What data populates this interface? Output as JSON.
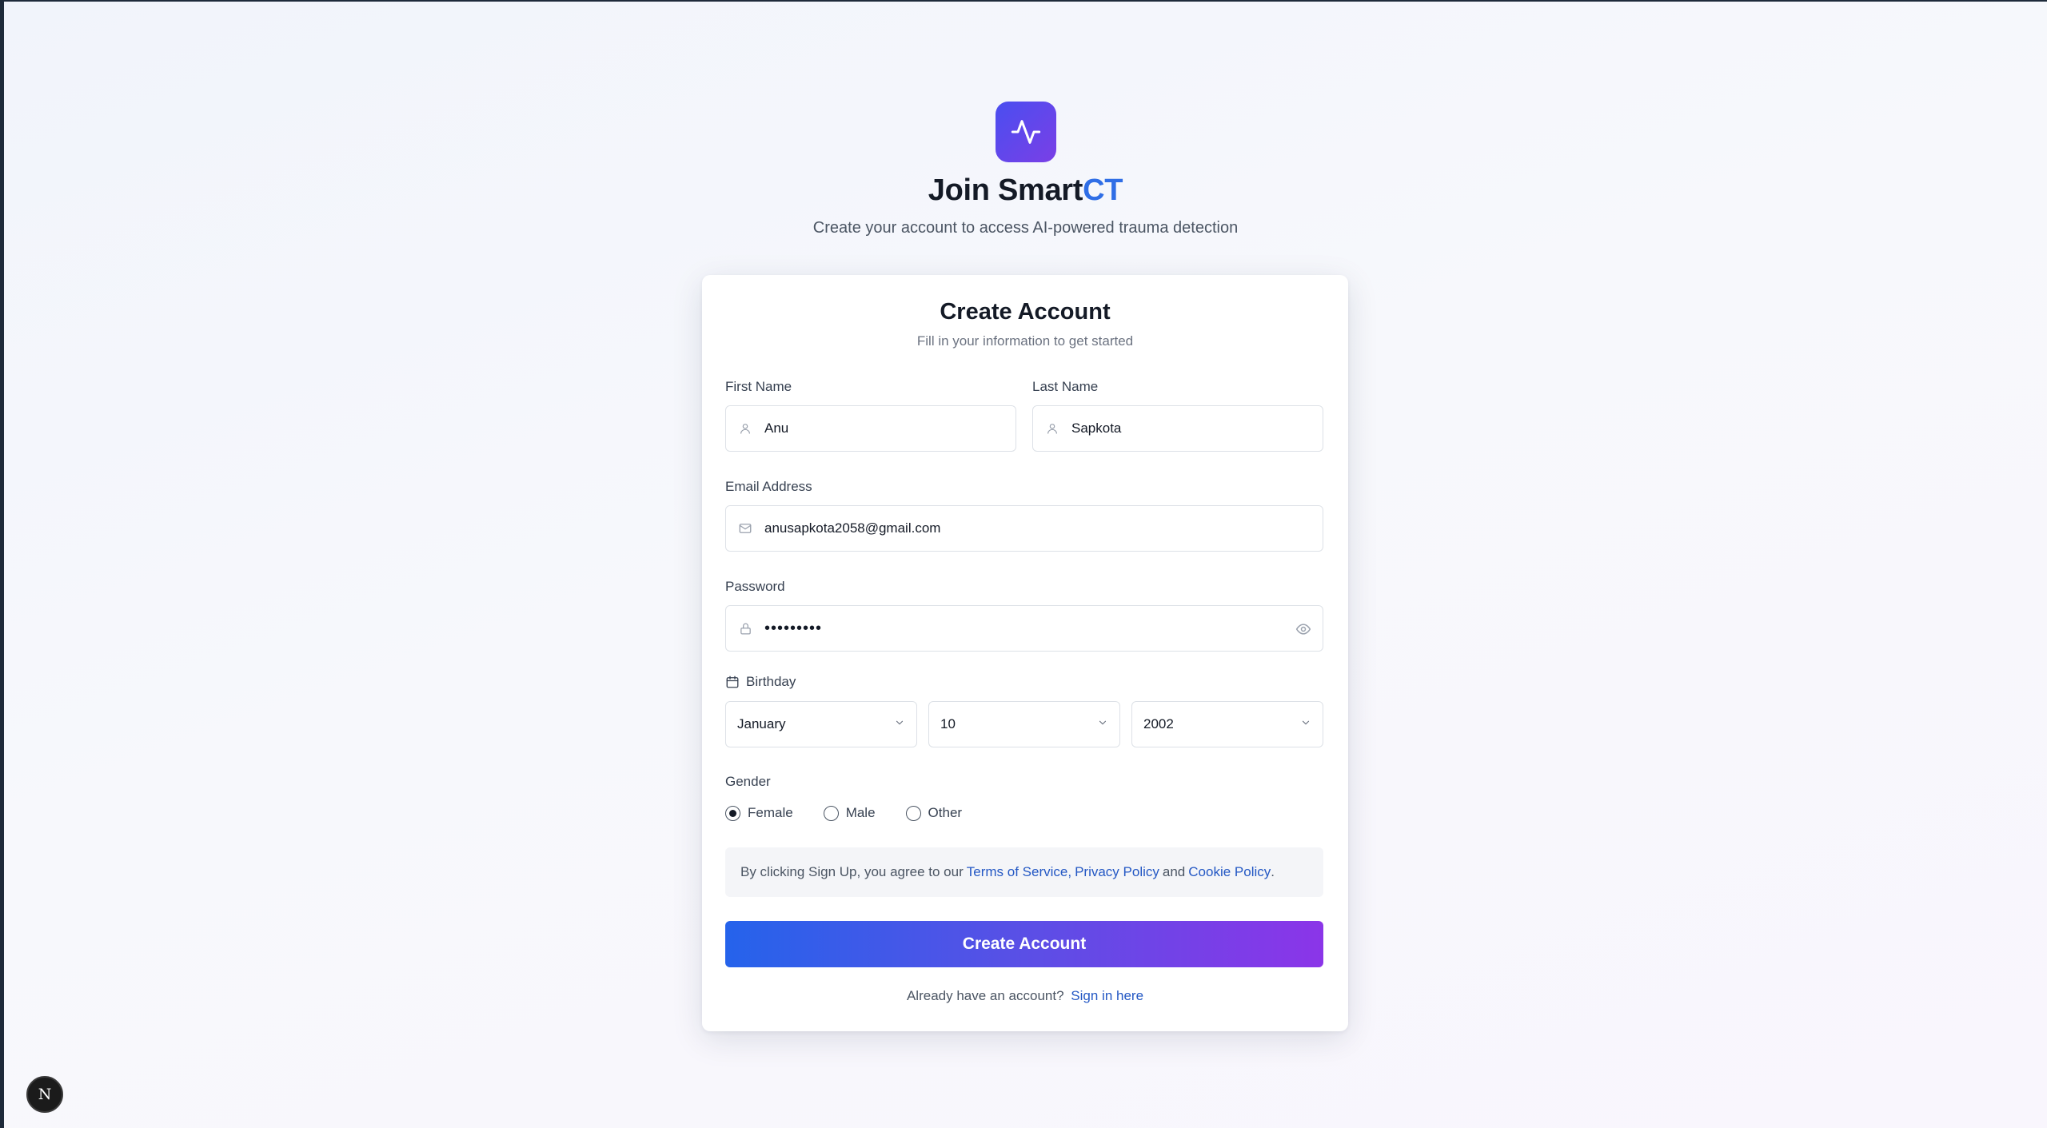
{
  "brand": {
    "title_prefix": "Join Smart",
    "title_accent": "CT",
    "subtitle": "Create your account to access AI-powered trauma detection",
    "logo_icon": "activity-icon",
    "accent_color": "#2f6ee6"
  },
  "card": {
    "title": "Create Account",
    "subtitle": "Fill in your information to get started"
  },
  "form": {
    "first_name": {
      "label": "First Name",
      "value": "Anu",
      "icon": "user-icon"
    },
    "last_name": {
      "label": "Last Name",
      "value": "Sapkota",
      "icon": "user-icon"
    },
    "email": {
      "label": "Email Address",
      "value": "anusapkota2058@gmail.com",
      "icon": "mail-icon"
    },
    "password": {
      "label": "Password",
      "value": "•••••••••",
      "icon": "lock-icon",
      "toggle_icon": "eye-icon"
    },
    "birthday": {
      "label": "Birthday",
      "icon": "calendar-icon",
      "month": "January",
      "day": "10",
      "year": "2002"
    },
    "gender": {
      "label": "Gender",
      "options": [
        "Female",
        "Male",
        "Other"
      ],
      "selected": "Female"
    },
    "terms": {
      "prefix": "By clicking Sign Up, you agree to our",
      "tos": "Terms of Service,",
      "privacy": "Privacy Policy",
      "and": "and",
      "cookie": "Cookie Policy",
      "suffix": "."
    },
    "submit_label": "Create Account",
    "signin_prompt": "Already have an account?",
    "signin_link": "Sign in here"
  },
  "dev_badge": {
    "label": "N"
  },
  "colors": {
    "button_gradient_start": "#2563eb",
    "button_gradient_end": "#8b35e8",
    "link": "#2458c4"
  }
}
